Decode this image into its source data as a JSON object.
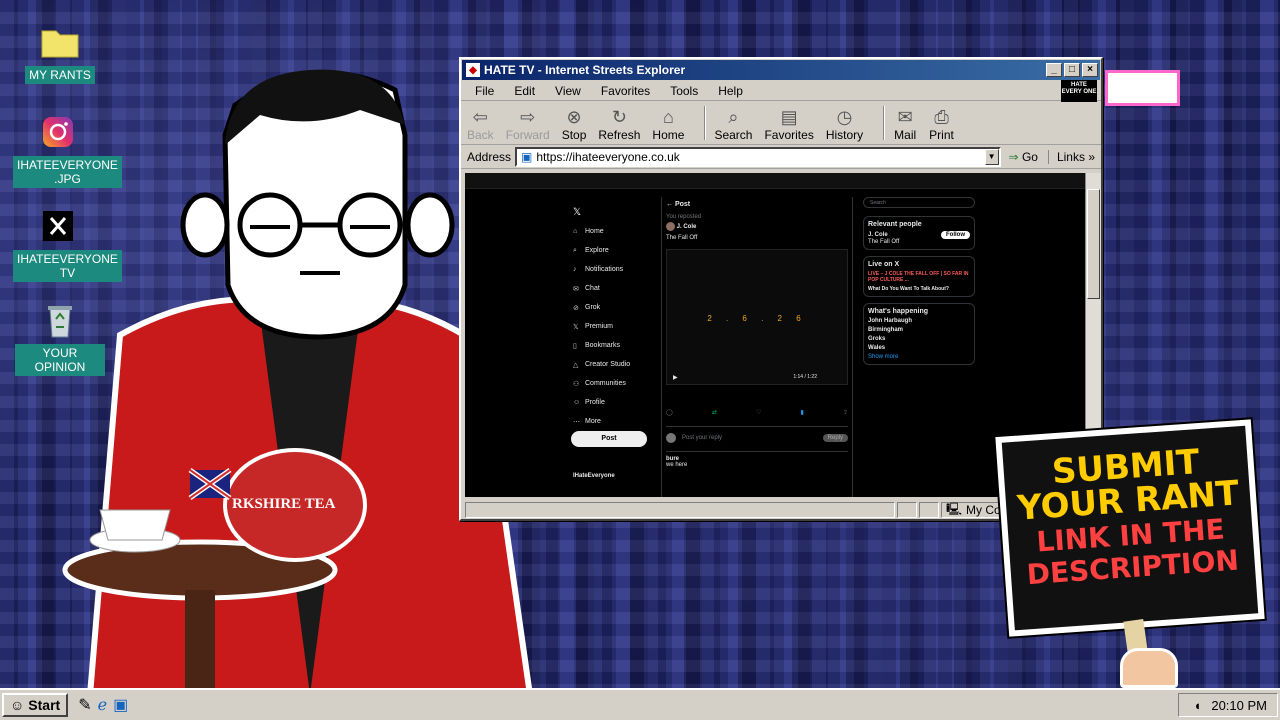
{
  "desktop": {
    "icons": [
      {
        "label": "MY RANTS",
        "icon": "folder-icon"
      },
      {
        "label": "IHATEEVERYONE\n.JPG",
        "icon": "instagram-icon"
      },
      {
        "label": "IHATEEVERYONE\nTV",
        "icon": "x-logo-icon"
      },
      {
        "label": "YOUR OPINION",
        "icon": "recycle-bin-icon"
      }
    ]
  },
  "window": {
    "title": "HATE TV - Internet Streets Explorer",
    "menu": [
      "File",
      "Edit",
      "View",
      "Favorites",
      "Tools",
      "Help"
    ],
    "logo_text": "HATE EVERY ONE",
    "toolbar": [
      {
        "label": "Back",
        "icon": "back-arrow-icon",
        "enabled": false
      },
      {
        "label": "Forward",
        "icon": "forward-arrow-icon",
        "enabled": false
      },
      {
        "label": "Stop",
        "icon": "stop-icon",
        "enabled": true
      },
      {
        "label": "Refresh",
        "icon": "refresh-icon",
        "enabled": true
      },
      {
        "label": "Home",
        "icon": "home-icon",
        "enabled": true
      },
      {
        "label": "Search",
        "icon": "search-icon",
        "enabled": true
      },
      {
        "label": "Favorites",
        "icon": "favorites-icon",
        "enabled": true
      },
      {
        "label": "History",
        "icon": "history-icon",
        "enabled": true
      },
      {
        "label": "Mail",
        "icon": "mail-icon",
        "enabled": true
      },
      {
        "label": "Print",
        "icon": "print-icon",
        "enabled": true
      }
    ],
    "address_label": "Address",
    "address_value": "https://ihateeveryone.co.uk",
    "go_label": "Go",
    "links_label": "Links",
    "status_zone": "My Computer"
  },
  "x_page": {
    "nav": [
      "Home",
      "Explore",
      "Notifications",
      "Chat",
      "Grok",
      "Premium",
      "Bookmarks",
      "Creator Studio",
      "Communities",
      "Profile",
      "More"
    ],
    "post_button": "Post",
    "header": "Post",
    "reposted": "You reposted",
    "author": "J. Cole",
    "post_text": "The Fall Off",
    "countdown": "2 . 6 . 2 6",
    "video_time": "1:14 / 1:22",
    "reply_placeholder": "Post your reply",
    "reply_button": "Reply",
    "reply_user": "bure",
    "reply_text": "we here",
    "profile_name": "IHateEveryone",
    "sidebar": {
      "search_placeholder": "Search",
      "relevant_title": "Relevant people",
      "relevant_name": "J. Cole",
      "relevant_bio": "The Fall Off",
      "follow": "Follow",
      "live_title": "Live on X",
      "live_1": "LIVE – J COLE THE FALL OFF | SO FAR IN POP CULTURE ...",
      "live_2": "What Do You Want To Talk About?",
      "happening_title": "What's happening",
      "trends": [
        "John Harbaugh",
        "Birmingham",
        "Groks",
        "Wales"
      ],
      "show_more": "Show more"
    }
  },
  "sign": {
    "line1": "SUBMIT",
    "line2": "YOUR RANT",
    "line3": "LINK IN THE",
    "line4": "DESCRIPTION"
  },
  "tea": {
    "label": "RKSHIRE TEA"
  },
  "taskbar": {
    "start": "Start",
    "clock": "20:10 PM"
  }
}
